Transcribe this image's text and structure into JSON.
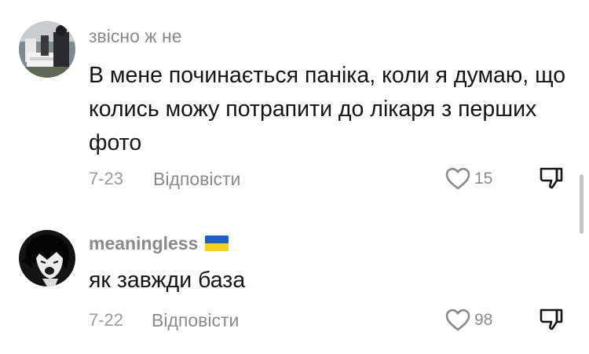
{
  "comments": [
    {
      "username": "звісно ж не",
      "text": "В мене починається паніка, коли я думаю, що колись можу потрапити до лікаря з перших фото",
      "date": "7-23",
      "reply_label": "Відповісти",
      "likes": "15",
      "avatar_icon": "user-avatar-photo",
      "like_icon": "heart-icon",
      "dislike_icon": "thumbs-down-icon"
    },
    {
      "username": "meaningless",
      "flag_icon": "ukraine-flag-icon",
      "text": "як завжди база",
      "date": "7-22",
      "reply_label": "Відповісти",
      "likes": "98",
      "avatar_icon": "anime-avatar",
      "like_icon": "heart-icon",
      "dislike_icon": "thumbs-down-icon"
    }
  ],
  "colors": {
    "text_primary": "#141414",
    "text_secondary": "#8a8a8e",
    "flag_blue": "#1f5fd0",
    "flag_yellow": "#f6d21b"
  }
}
